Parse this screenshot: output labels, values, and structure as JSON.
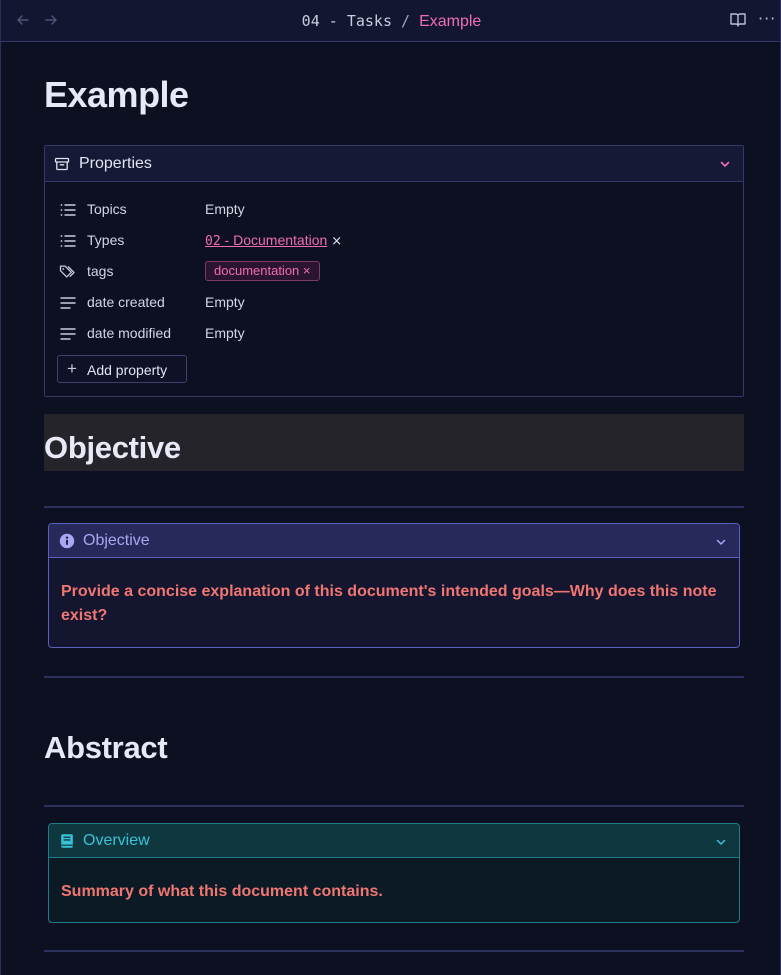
{
  "titlebar": {
    "back_icon": "arrow-left-icon",
    "forward_icon": "arrow-right-icon",
    "breadcrumb_parent": "04 - Tasks",
    "breadcrumb_separator": " / ",
    "breadcrumb_current": "Example",
    "reading_view_icon": "book-open-icon",
    "more_icon": "more-horizontal-icon",
    "more_label": "···"
  },
  "page": {
    "title": "Example"
  },
  "properties": {
    "header": "Properties",
    "rows": [
      {
        "key": "Topics",
        "value": "Empty"
      },
      {
        "key": "Types",
        "link_prefix": "02",
        "link_label": " - Documentation",
        "remove": "×"
      },
      {
        "key": "tags",
        "tag": "documentation",
        "tag_remove": "×"
      },
      {
        "key": "date created",
        "value": "Empty"
      },
      {
        "key": "date modified",
        "value": "Empty"
      }
    ],
    "add_label": "Add property",
    "add_symbol": "+"
  },
  "sections": {
    "objective_heading": "Objective",
    "objective_callout": {
      "title": "Objective",
      "body": "Provide a concise explanation of this document's intended goals—Why does this note exist?"
    },
    "abstract_heading": "Abstract",
    "overview_callout": {
      "title": "Overview",
      "body": "Summary of what this document contains."
    }
  },
  "colors": {
    "background": "#0d1020",
    "accent_pink": "#ef6eb3",
    "callout_text": "#f07672",
    "objective_accent": "#5a5fc0",
    "overview_accent": "#1f7c87"
  }
}
